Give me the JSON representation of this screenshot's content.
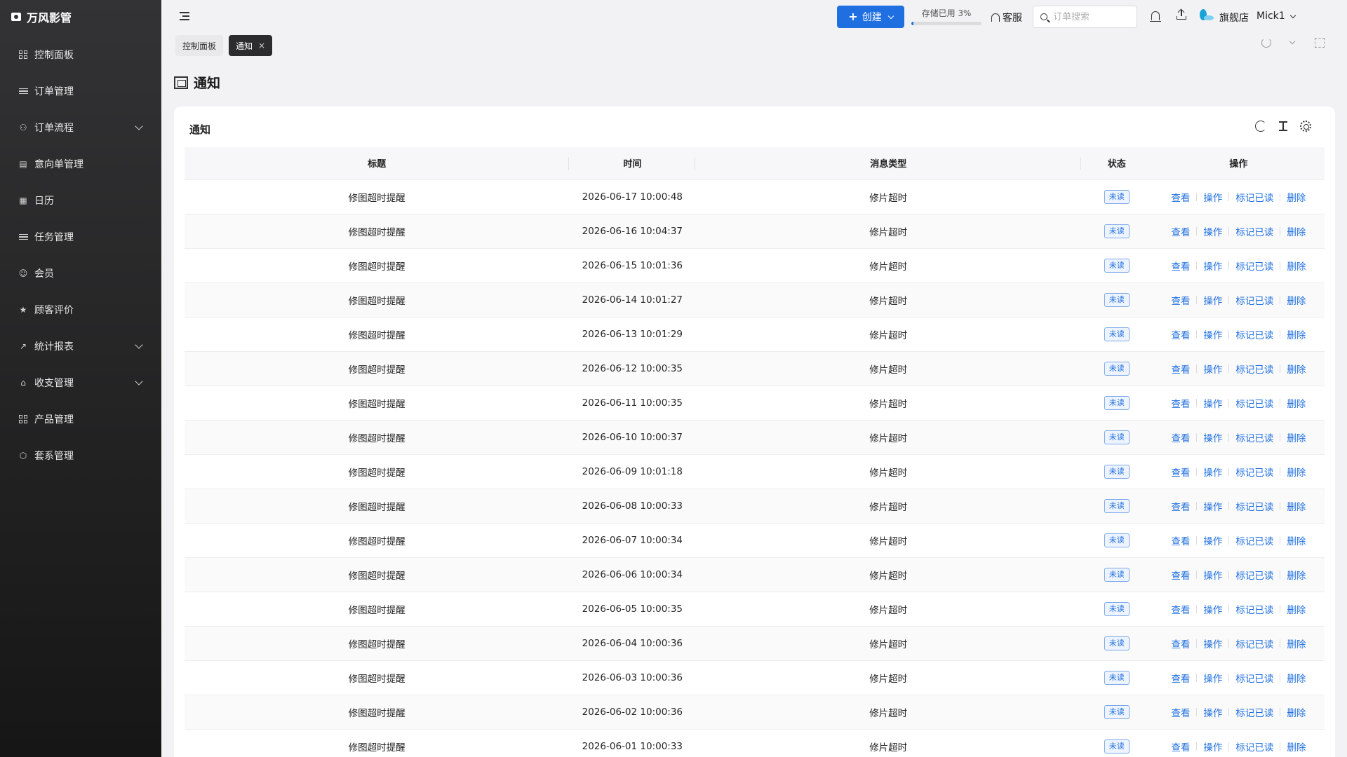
{
  "app": {
    "name": "万风影管"
  },
  "sidebar": {
    "items": [
      {
        "label": "控制面板",
        "icon": "dashboard-icon",
        "expandable": false
      },
      {
        "label": "订单管理",
        "icon": "list-icon",
        "expandable": false
      },
      {
        "label": "订单流程",
        "icon": "flow-icon",
        "expandable": true
      },
      {
        "label": "意向单管理",
        "icon": "clipboard-icon",
        "expandable": false
      },
      {
        "label": "日历",
        "icon": "calendar-icon",
        "expandable": false
      },
      {
        "label": "任务管理",
        "icon": "task-list-icon",
        "expandable": false
      },
      {
        "label": "会员",
        "icon": "user-icon",
        "expandable": false
      },
      {
        "label": "顾客评价",
        "icon": "star-icon",
        "expandable": false
      },
      {
        "label": "统计报表",
        "icon": "chart-icon",
        "expandable": true
      },
      {
        "label": "收支管理",
        "icon": "bank-icon",
        "expandable": true
      },
      {
        "label": "产品管理",
        "icon": "product-icon",
        "expandable": false
      },
      {
        "label": "套系管理",
        "icon": "package-icon",
        "expandable": false
      }
    ]
  },
  "header": {
    "create_label": "创建",
    "storage_label": "存储已用 3%",
    "storage_percent": 3,
    "service_label": "客服",
    "search_placeholder": "订单搜索",
    "store_name": "旗舰店",
    "user_name": "Mick1",
    "accent_color": "#1f6fe0"
  },
  "tabs": [
    {
      "label": "控制面板",
      "active": false
    },
    {
      "label": "通知",
      "active": true,
      "close": "×"
    }
  ],
  "page": {
    "title": "通知"
  },
  "card": {
    "title": "通知"
  },
  "table": {
    "columns": [
      "标题",
      "时间",
      "消息类型",
      "状态",
      "操作"
    ],
    "actions": [
      "查看",
      "操作",
      "标记已读",
      "删除"
    ],
    "rows": [
      {
        "title": "修图超时提醒",
        "time": "2026-06-17 10:00:48",
        "type": "修片超时",
        "status": "未读"
      },
      {
        "title": "修图超时提醒",
        "time": "2026-06-16 10:04:37",
        "type": "修片超时",
        "status": "未读"
      },
      {
        "title": "修图超时提醒",
        "time": "2026-06-15 10:01:36",
        "type": "修片超时",
        "status": "未读"
      },
      {
        "title": "修图超时提醒",
        "time": "2026-06-14 10:01:27",
        "type": "修片超时",
        "status": "未读"
      },
      {
        "title": "修图超时提醒",
        "time": "2026-06-13 10:01:29",
        "type": "修片超时",
        "status": "未读"
      },
      {
        "title": "修图超时提醒",
        "time": "2026-06-12 10:00:35",
        "type": "修片超时",
        "status": "未读"
      },
      {
        "title": "修图超时提醒",
        "time": "2026-06-11 10:00:35",
        "type": "修片超时",
        "status": "未读"
      },
      {
        "title": "修图超时提醒",
        "time": "2026-06-10 10:00:37",
        "type": "修片超时",
        "status": "未读"
      },
      {
        "title": "修图超时提醒",
        "time": "2026-06-09 10:01:18",
        "type": "修片超时",
        "status": "未读"
      },
      {
        "title": "修图超时提醒",
        "time": "2026-06-08 10:00:33",
        "type": "修片超时",
        "status": "未读"
      },
      {
        "title": "修图超时提醒",
        "time": "2026-06-07 10:00:34",
        "type": "修片超时",
        "status": "未读"
      },
      {
        "title": "修图超时提醒",
        "time": "2026-06-06 10:00:34",
        "type": "修片超时",
        "status": "未读"
      },
      {
        "title": "修图超时提醒",
        "time": "2026-06-05 10:00:35",
        "type": "修片超时",
        "status": "未读"
      },
      {
        "title": "修图超时提醒",
        "time": "2026-06-04 10:00:36",
        "type": "修片超时",
        "status": "未读"
      },
      {
        "title": "修图超时提醒",
        "time": "2026-06-03 10:00:36",
        "type": "修片超时",
        "status": "未读"
      },
      {
        "title": "修图超时提醒",
        "time": "2026-06-02 10:00:36",
        "type": "修片超时",
        "status": "未读"
      },
      {
        "title": "修图超时提醒",
        "time": "2026-06-01 10:00:33",
        "type": "修片超时",
        "status": "未读"
      }
    ]
  }
}
